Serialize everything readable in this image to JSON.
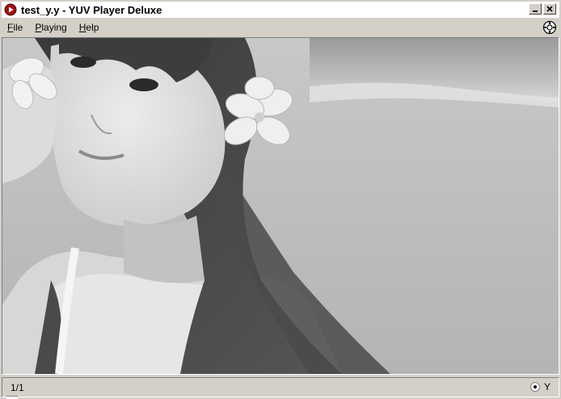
{
  "window": {
    "title": "test_y.y - YUV Player Deluxe",
    "minimize_label": "_",
    "close_label": "✕"
  },
  "menu": {
    "items": [
      {
        "label": "File",
        "accel": "F"
      },
      {
        "label": "Playing",
        "accel": "P"
      },
      {
        "label": "Help",
        "accel": "H"
      }
    ]
  },
  "video": {
    "description_icon": "video-frame-grayscale"
  },
  "status": {
    "frame_counter": "1/1",
    "plane_label": "Y",
    "plane_selected": true
  },
  "colors": {
    "titlebar_bg": "#ffffff",
    "chrome": "#d4d0c8",
    "app_icon": "#a01010"
  }
}
